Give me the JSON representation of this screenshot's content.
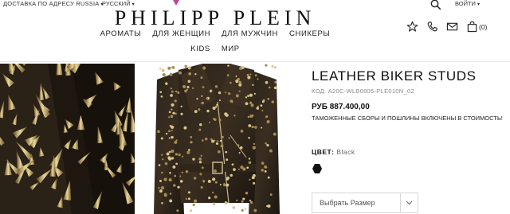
{
  "header": {
    "shipping_label": "ДОСТАВКА ПО АДРЕСУ RUSSIA",
    "language_label": "РУССКИЙ",
    "logo_text": "PHILIPP PLEIN",
    "login_label": "ВОЙТИ",
    "cart_count": "(0)",
    "accent_color": "#c0449a"
  },
  "nav": {
    "row1": [
      "АРОМАТЫ",
      "ДЛЯ ЖЕНЩИН",
      "ДЛЯ МУЖЧИН",
      "СНИКЕРЫ"
    ],
    "row2": [
      "KIDS",
      "МИР"
    ]
  },
  "icons": [
    "search-icon",
    "star-icon",
    "phone-icon",
    "mail-icon",
    "bag-icon"
  ],
  "product": {
    "title": "LEATHER BIKER STUDS",
    "code": "КОД: A20C-WLB0805-PLE010N_02",
    "price": "РУБ 887.400,00",
    "duty_note": "ТАМОЖЕННЫЕ СБОРЫ И ПОШЛИНЫ ВКЛЮЧЕНЫ В СТОИМОСТЬ!",
    "color_label": "ЦВЕТ:",
    "color_value": "Black",
    "swatch_color": "#111111",
    "size_placeholder": "Выбрать Размер"
  }
}
